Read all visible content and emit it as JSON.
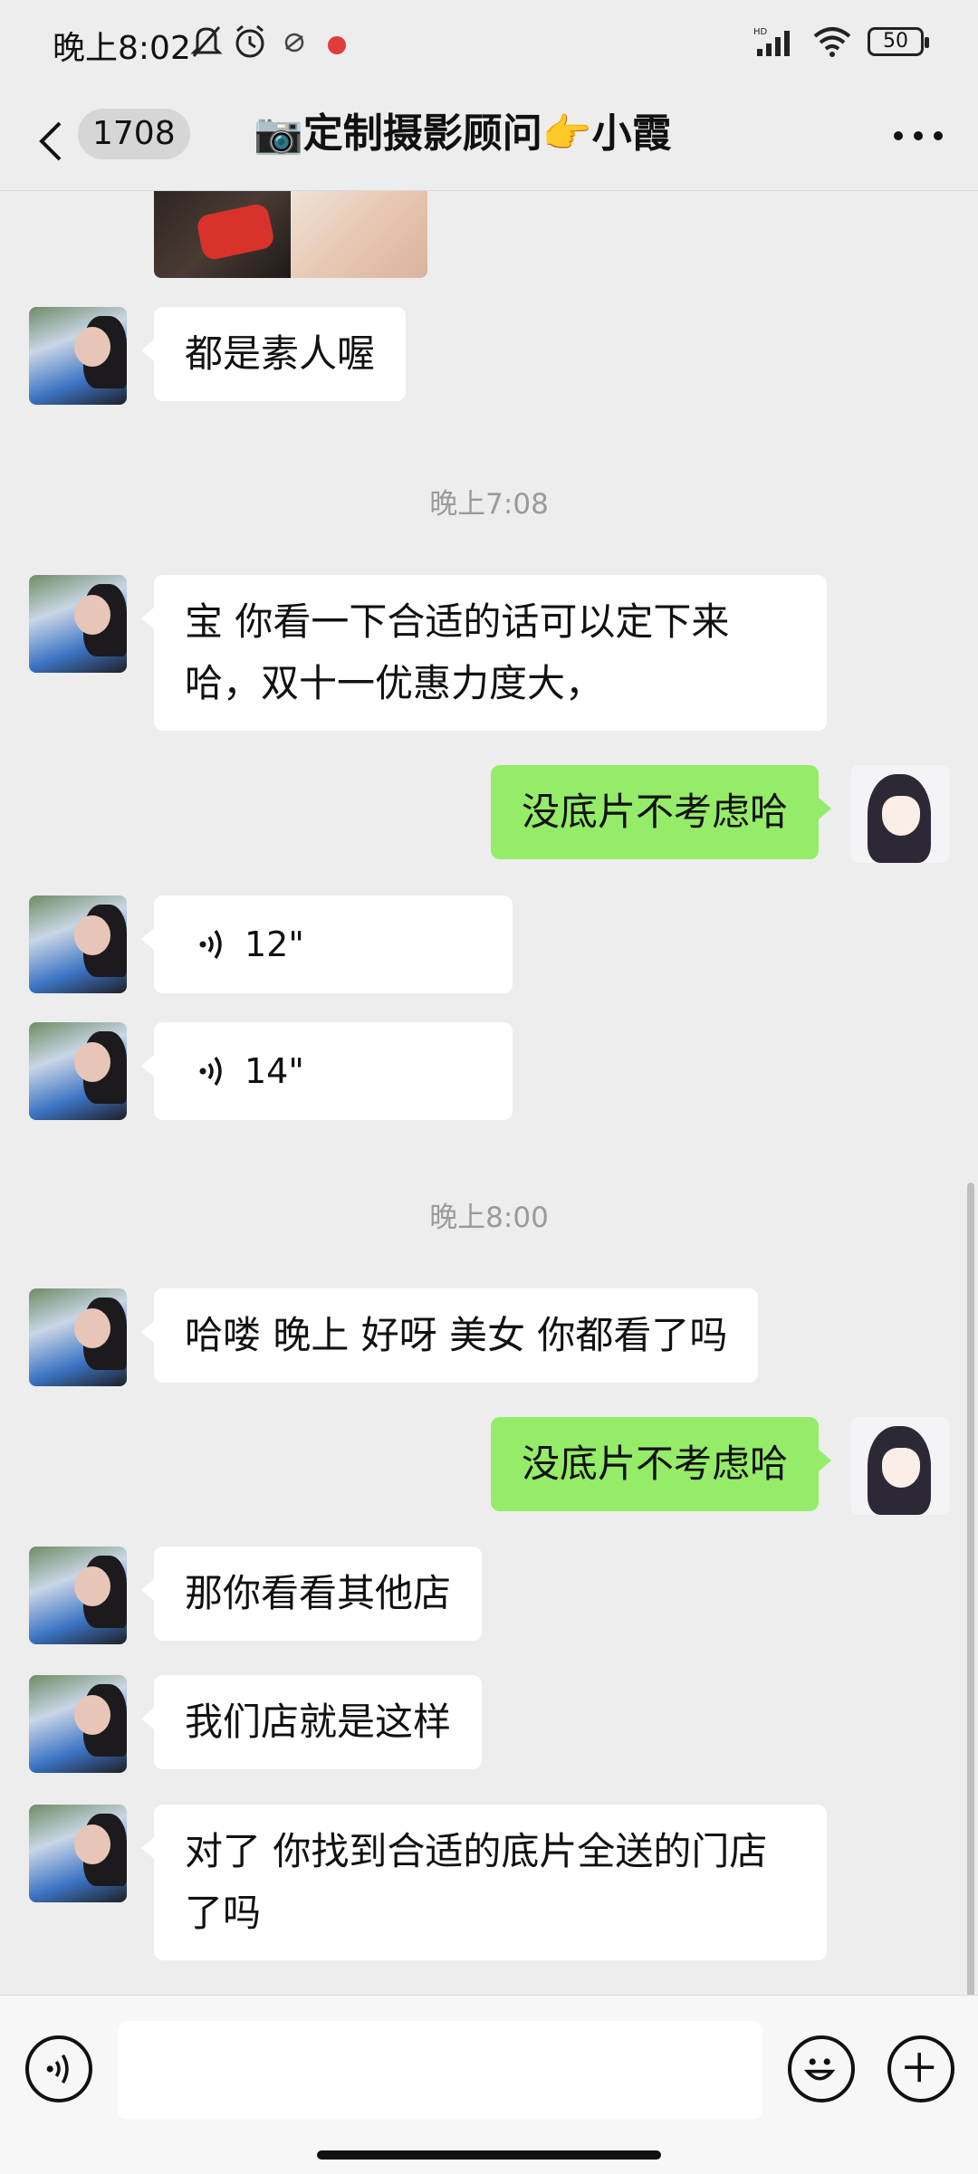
{
  "status_bar": {
    "time": "晚上8:02",
    "battery": "50",
    "icons": [
      "mute-bell-icon",
      "alarm-icon",
      "sync-icon",
      "record-dot-icon",
      "hd-signal-icon",
      "wifi-icon",
      "battery-icon"
    ]
  },
  "header": {
    "unread_count": "1708",
    "title": "📷定制摄影顾问👉小霞",
    "icons": [
      "back-chevron-icon",
      "more-dots-icon"
    ]
  },
  "messages": [
    {
      "type": "image",
      "from": "her"
    },
    {
      "type": "text",
      "from": "her",
      "text": "都是素人喔"
    },
    {
      "type": "time",
      "text": "晚上7:08"
    },
    {
      "type": "text",
      "from": "her",
      "text": "宝 你看一下合适的话可以定下来哈，双十一优惠力度大，"
    },
    {
      "type": "text",
      "from": "me",
      "text": "没底片不考虑哈"
    },
    {
      "type": "voice",
      "from": "her",
      "duration": "12\""
    },
    {
      "type": "voice",
      "from": "her",
      "duration": "14\""
    },
    {
      "type": "time",
      "text": "晚上8:00"
    },
    {
      "type": "text",
      "from": "her",
      "text": "哈喽 晚上 好呀 美女 你都看了吗"
    },
    {
      "type": "text",
      "from": "me",
      "text": "没底片不考虑哈"
    },
    {
      "type": "text",
      "from": "her",
      "text": "那你看看其他店"
    },
    {
      "type": "text",
      "from": "her",
      "text": "我们店就是这样"
    },
    {
      "type": "text",
      "from": "her",
      "text": "对了 你找到合适的底片全送的门店了吗"
    }
  ],
  "input_bar": {
    "icons": [
      "voice-input-icon",
      "emoji-icon",
      "plus-icon"
    ]
  },
  "colors": {
    "background": "#ededed",
    "my_bubble": "#95ec69",
    "their_bubble": "#ffffff",
    "timestamp": "#9a9a9a"
  }
}
